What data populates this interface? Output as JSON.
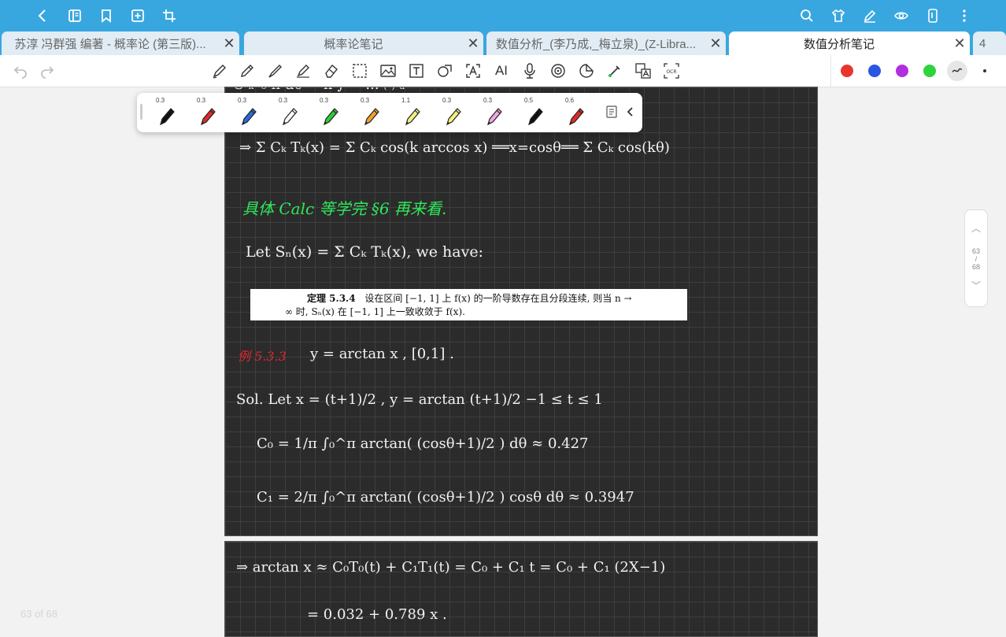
{
  "tabs": [
    {
      "label": "苏淳 冯群强 编著 - 概率论 (第三版)..."
    },
    {
      "label": "概率论笔记"
    },
    {
      "label": "数值分析_(李乃成,_梅立泉)_(Z-Libra..."
    },
    {
      "label": "数值分析笔记"
    },
    {
      "label": "4"
    }
  ],
  "icons": {
    "back": "chevron-left-icon",
    "book": "book-icon",
    "bookmark": "bookmark-icon",
    "add": "add-page-icon",
    "crop": "crop-icon",
    "search": "search-icon",
    "shirt": "theme-icon",
    "pen": "pen-icon",
    "eye": "eye-icon",
    "tablet": "tablet-icon",
    "more": "more-icon"
  },
  "toolbar": {
    "ocr": "OCR",
    "ai": "AI",
    "colors": [
      "#e8352d",
      "#2a55e5",
      "#b22ee0",
      "#2fd33c"
    ]
  },
  "pens": [
    {
      "size": "0.3",
      "color": "#111111"
    },
    {
      "size": "0.3",
      "color": "#e02a2a"
    },
    {
      "size": "0.3",
      "color": "#2e6ad6"
    },
    {
      "size": "0.3",
      "color": "#ffffff"
    },
    {
      "size": "0.3",
      "color": "#2fc93a"
    },
    {
      "size": "0.3",
      "color": "#f0a030"
    },
    {
      "size": "1.1",
      "color": "#f2f080"
    },
    {
      "size": "0.3",
      "color": "#f2f080"
    },
    {
      "size": "0.3",
      "color": "#f2a8dc"
    },
    {
      "size": "0.5",
      "color": "#111111"
    },
    {
      "size": "0.6",
      "color": "#e02a2a"
    }
  ],
  "scroll": {
    "current": "63",
    "sep": "/",
    "total": "68"
  },
  "page_counter": "63 of 68",
  "notes": {
    "line_sum": "⇒  Σ Cₖ Tₖ(x)  =  Σ Cₖ cos(k arccos x)  ══x=cosθ══  Σ Cₖ cos(kθ)",
    "green_note": "具体 Calc 等学完 §6 再来看.",
    "let_line": "Let   Sₙ(x) = Σ Cₖ Tₖ(x),     we have:",
    "theorem_head": "定理 5.3.4",
    "theorem_body": "设在区间 [−1, 1] 上 f(x) 的一阶导数存在且分段连续, 则当 n →",
    "theorem_body2": "∞ 时, Sₙ(x) 在 [−1, 1] 上一致收敛于 f(x).",
    "example_label": "例 5.3.3",
    "example_text": "y = arctan x ,    [0,1] .",
    "sol_line": "Sol.   Let   x = (t+1)/2 ,      y = arctan (t+1)/2         −1 ≤ t ≤ 1",
    "c0_line": "C₀ = 1/π ∫₀^π arctan( (cosθ+1)/2 ) dθ  ≈ 0.427",
    "c1_line": "C₁ = 2/π ∫₀^π arctan( (cosθ+1)/2 ) cosθ dθ   ≈ 0.3947",
    "approx_line": "⇒  arctan x ≈ C₀T₀(t) + C₁T₁(t)  = C₀ + C₁ t  =  C₀ + C₁ (2X−1)",
    "result_line": "= 0.032  + 0.789  x ."
  }
}
